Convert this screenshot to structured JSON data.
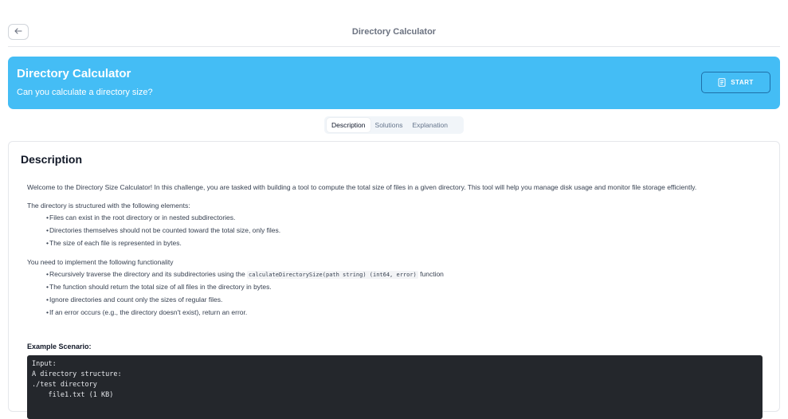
{
  "header": {
    "title": "Directory Calculator",
    "back_icon": "arrow-left-icon"
  },
  "banner": {
    "title": "Directory Calculator",
    "subtitle": "Can you calculate a directory size?",
    "start_label": "START",
    "color": "#44bdf5"
  },
  "tabs": [
    {
      "label": "Description",
      "active": true
    },
    {
      "label": "Solutions",
      "active": false
    },
    {
      "label": "Explanation",
      "active": false
    }
  ],
  "description": {
    "heading": "Description",
    "intro": "Welcome to the Directory Size Calculator! In this challenge, you are tasked with building a tool to compute the total size of files in a given directory. This tool will help you manage disk usage and monitor file storage efficiently.",
    "structure_intro": "The directory is structured with the following elements:",
    "structure_items": [
      "Files can exist in the root directory or in nested subdirectories.",
      "Directories themselves should not be counted toward the total size, only files.",
      "The size of each file is represented in bytes."
    ],
    "functionality_intro": "You need to implement the following functionality",
    "func_item1_prefix": "Recursively traverse the directory and its subdirectories using the",
    "func_item1_code": "calculateDirectorySize(path string) (int64, error)",
    "func_item1_suffix": "function",
    "functionality_items": [
      "The function should return the total size of all files in the directory in bytes.",
      "Ignore directories and count only the sizes of regular files.",
      "If an error occurs (e.g., the directory doesn't exist), return an error."
    ],
    "example_label": "Example Scenario:",
    "code_lines": [
      "Input:",
      "A directory structure:",
      "./test directory",
      "    file1.txt (1 KB)"
    ]
  }
}
